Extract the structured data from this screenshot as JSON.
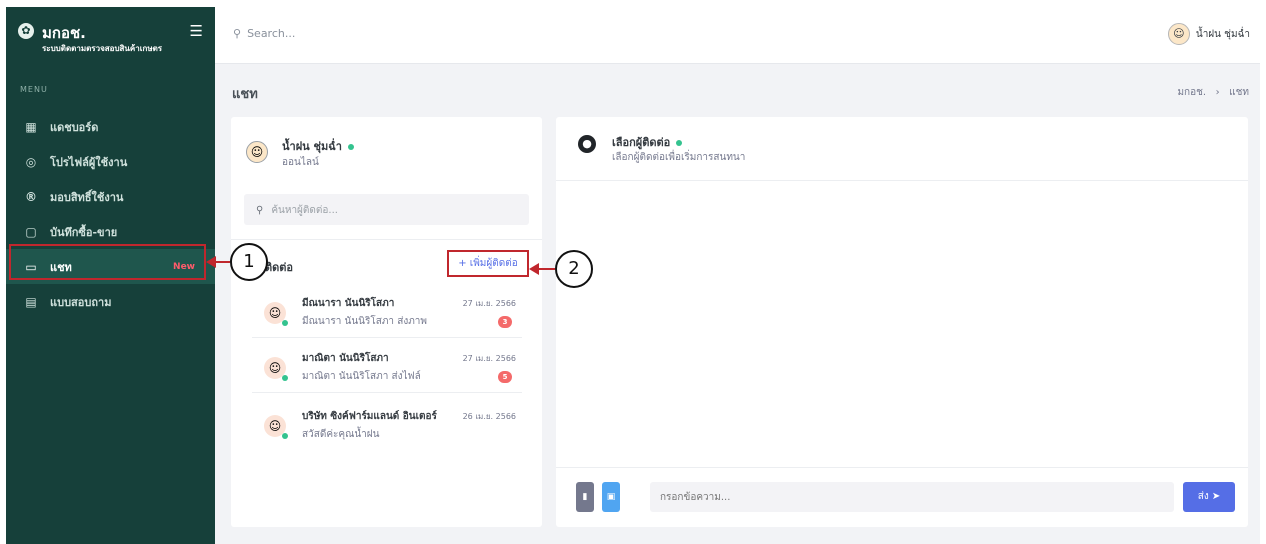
{
  "app": {
    "name": "มกอช.",
    "subtitle": "ระบบติดตามตรวจสอบสินค้าเกษตร"
  },
  "sidebar": {
    "menu_header": "MENU",
    "items": [
      {
        "label": "แดชบอร์ด",
        "icon": "dashboard-icon"
      },
      {
        "label": "โปรไฟล์ผู้ใช้งาน",
        "icon": "user-circle-icon"
      },
      {
        "label": "มอบสิทธิ์ใช้งาน",
        "icon": "registered-icon"
      },
      {
        "label": "บันทึกซื้อ-ขาย",
        "icon": "form-icon"
      },
      {
        "label": "แชท",
        "icon": "chat-icon",
        "badge": "New",
        "active": true
      },
      {
        "label": "แบบสอบถาม",
        "icon": "list-icon"
      }
    ]
  },
  "topbar": {
    "search_placeholder": "Search...",
    "user_name": "น้ำฝน ชุ่มฉ่ำ"
  },
  "page": {
    "title": "แชท",
    "breadcrumb": [
      "มกอช.",
      "แชท"
    ]
  },
  "contacts_panel": {
    "me_name": "น้ำฝน ชุ่มฉ่ำ",
    "me_status": "ออนไลน์",
    "search_placeholder": "ค้นหาผู้ติดต่อ...",
    "section_title": "ติดต่อ",
    "add_label": "+ เพิ่มผู้ติดต่อ",
    "contacts": [
      {
        "name": "มีณนารา นันนิริโสภา",
        "message": "มีณนารา นันนิริโสภา ส่งภาพ",
        "date": "27 เม.ย. 2566",
        "unread": "3"
      },
      {
        "name": "มาณิตา นันนิริโสภา",
        "message": "มาณิตา นันนิริโสภา ส่งไฟล์",
        "date": "27 เม.ย. 2566",
        "unread": "5"
      },
      {
        "name": "บริษัท ซิงค์ฟาร์มแลนด์ อินเตอร์",
        "message": "สวัสดีค่ะคุณน้ำฝน",
        "date": "26 เม.ย. 2566",
        "unread": ""
      }
    ]
  },
  "chat_panel": {
    "title": "เลือกผู้ติดต่อ",
    "subtitle": "เลือกผู้ติดต่อเพื่อเริ่มการสนทนา",
    "input_placeholder": "กรอกข้อความ...",
    "send_label": "ส่ง ➤"
  },
  "annotations": {
    "callout_1": "1",
    "callout_2": "2"
  },
  "colors": {
    "sidebar_bg": "#16403a",
    "accent": "#556ee6",
    "highlight": "#c0272d",
    "online": "#34c38f",
    "badge": "#f46a6a"
  }
}
